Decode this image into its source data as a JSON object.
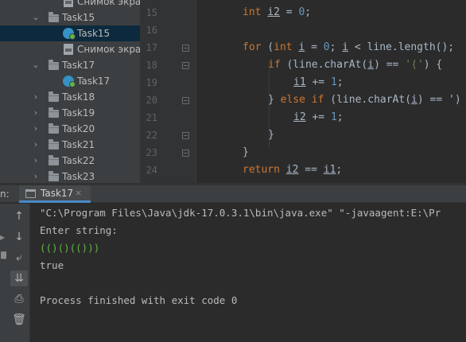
{
  "project_tree": {
    "items": [
      {
        "label": "Снимок экран",
        "icon": "image-file-icon",
        "arrow": ""
      },
      {
        "label": "Task15",
        "icon": "folder-icon",
        "arrow": "v"
      },
      {
        "label": "Task15",
        "icon": "java-class-icon",
        "arrow": "",
        "selected": true
      },
      {
        "label": "Снимок экран",
        "icon": "image-file-icon",
        "arrow": ""
      },
      {
        "label": "Task17",
        "icon": "folder-icon",
        "arrow": "v"
      },
      {
        "label": "Task17",
        "icon": "java-class-icon",
        "arrow": ""
      },
      {
        "label": "Task18",
        "icon": "folder-icon",
        "arrow": ">"
      },
      {
        "label": "Task19",
        "icon": "folder-icon",
        "arrow": ">"
      },
      {
        "label": "Task20",
        "icon": "folder-icon",
        "arrow": ">"
      },
      {
        "label": "Task21",
        "icon": "folder-icon",
        "arrow": ">"
      },
      {
        "label": "Task22",
        "icon": "folder-icon",
        "arrow": ">"
      },
      {
        "label": "Task23",
        "icon": "folder-icon",
        "arrow": ">"
      }
    ]
  },
  "editor": {
    "line_numbers": [
      "15",
      "16",
      "17",
      "18",
      "19",
      "20",
      "21",
      "22",
      "23",
      "24"
    ],
    "code": {
      "line15": {
        "type": "int",
        "var": "i2",
        "rest": " = ",
        "zero": "0",
        "end": ";"
      },
      "line17": {
        "kw_for": "for",
        "open": " (",
        "kw_int": "int",
        "sp": " ",
        "var_i": "i",
        "mid1": " = ",
        "zero": "0",
        "mid2": "; ",
        "var_i2": "i",
        "rest": " < line.length();"
      },
      "line18": {
        "kw_if": "if",
        "open": " (line.charAt(",
        "var_i": "i",
        "mid": ") == ",
        "char": "'('",
        "end": ") {"
      },
      "line19": {
        "var": "i1",
        "mid": " += ",
        "one": "1",
        "end": ";"
      },
      "line20": {
        "open": "} ",
        "kw_else": "else",
        "sp": " ",
        "kw_if": "if",
        "mid": " (line.charAt(",
        "var_i": "i",
        "rest": ") == ')"
      },
      "line21": {
        "var": "i2",
        "mid": " += ",
        "one": "1",
        "end": ";"
      },
      "line22": {
        "text": "}"
      },
      "line23": {
        "text": "}"
      },
      "line24": {
        "kw_return": "return",
        "sp": " ",
        "var_a": "i2",
        "mid": " == ",
        "var_b": "i1",
        "end": ";"
      }
    }
  },
  "run_panel": {
    "label": "n:",
    "tab": {
      "title": "Task17",
      "close": "×"
    },
    "console": {
      "command": "\"C:\\Program Files\\Java\\jdk-17.0.3.1\\bin\\java.exe\" \"-javaagent:E:\\Pr",
      "prompt": "Enter string:",
      "input": "(()()(()))",
      "result": "true",
      "exit": "Process finished with exit code 0"
    },
    "toolbar": [
      {
        "name": "up-arrow-icon",
        "glyph": "↑"
      },
      {
        "name": "down-arrow-icon",
        "glyph": "↓"
      },
      {
        "name": "soft-wrap-icon",
        "glyph": "⤶"
      },
      {
        "name": "scroll-to-end-icon",
        "glyph": "⇊"
      },
      {
        "name": "print-icon",
        "glyph": "⎙"
      },
      {
        "name": "trash-icon",
        "glyph": "🗑"
      }
    ]
  },
  "colors": {
    "keyword": "#cc7832",
    "number": "#6897bb",
    "string": "#6a8759",
    "identifier": "#a9b7c6",
    "console_input": "#62b543",
    "selection": "#0d293e",
    "tab_underline": "#4a88c7"
  }
}
